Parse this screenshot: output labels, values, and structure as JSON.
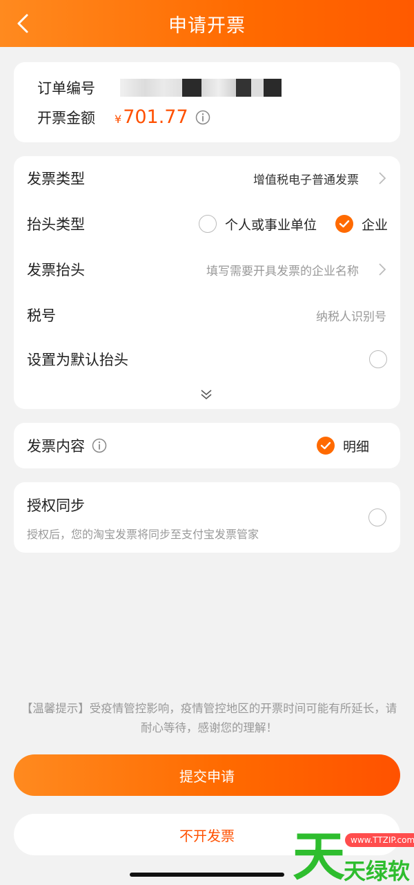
{
  "header": {
    "title": "申请开票"
  },
  "order": {
    "number_label": "订单编号",
    "amount_label": "开票金额",
    "currency": "¥",
    "amount": "701.77"
  },
  "form": {
    "invoice_type": {
      "label": "发票类型",
      "value": "增值税电子普通发票"
    },
    "title_type": {
      "label": "抬头类型",
      "options": [
        "个人或事业单位",
        "企业"
      ],
      "selected": "企业"
    },
    "invoice_title": {
      "label": "发票抬头",
      "placeholder": "填写需要开具发票的企业名称"
    },
    "tax_id": {
      "label": "税号",
      "placeholder": "纳税人识别号"
    },
    "default_title": {
      "label": "设置为默认抬头"
    }
  },
  "content": {
    "label": "发票内容",
    "option": "明细"
  },
  "auth": {
    "label": "授权同步",
    "desc": "授权后，您的淘宝发票将同步至支付宝发票管家"
  },
  "notice": "【温馨提示】受疫情管控影响，疫情管控地区的开票时间可能有所延长，请耐心等待，感谢您的理解！",
  "buttons": {
    "submit": "提交申请",
    "no_invoice": "不开发票"
  },
  "watermark": {
    "big": "天",
    "url": "www.TTZIP.com",
    "name": "天绿软"
  },
  "colors": {
    "accent": "#ff6a00",
    "price": "#ff5000"
  }
}
